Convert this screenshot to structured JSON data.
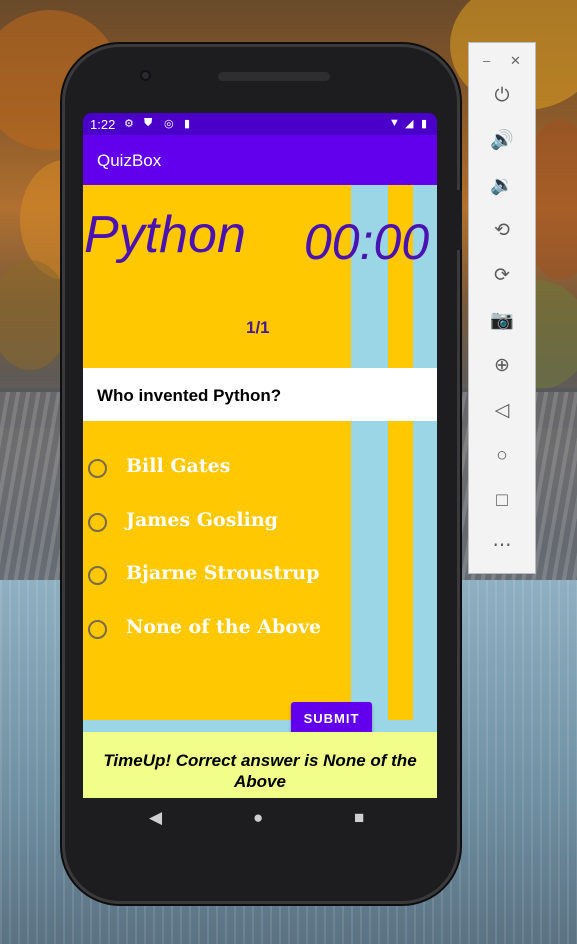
{
  "status_bar": {
    "time": "1:22",
    "left_icons": [
      "settings-icon",
      "shield-icon",
      "sync-icon",
      "sd-card-icon"
    ],
    "right_icons": [
      "wifi-icon",
      "signal-icon",
      "battery-icon"
    ]
  },
  "app": {
    "title": "QuizBox",
    "accent": "#6200ee",
    "status_color": "#4b00c9"
  },
  "quiz": {
    "subject": "Python",
    "timer": "00:00",
    "counter": "1/1",
    "question": "Who invented Python?",
    "options": [
      {
        "label": "Bill Gates",
        "selected": false
      },
      {
        "label": "James Gosling",
        "selected": false
      },
      {
        "label": "Bjarne Stroustrup",
        "selected": false
      },
      {
        "label": "None of the Above",
        "selected": false
      }
    ],
    "submit_label": "SUBMIT",
    "result_text": "TimeUp! Correct answer is None of the Above"
  },
  "colors": {
    "panel_yellow": "#ffc800",
    "panel_blue": "#9ad6e6",
    "result_bg": "#f1ff8a",
    "heading_purple": "#4a12b0"
  },
  "emulator_toolbar": {
    "window_controls": [
      "minimize-icon",
      "close-icon"
    ],
    "buttons": [
      "power-icon",
      "volume-up-icon",
      "volume-down-icon",
      "rotate-left-icon",
      "rotate-right-icon",
      "camera-icon",
      "zoom-icon",
      "back-icon",
      "home-icon",
      "overview-icon",
      "more-icon"
    ]
  },
  "nav_bar": [
    "back-icon",
    "home-icon",
    "overview-icon"
  ]
}
